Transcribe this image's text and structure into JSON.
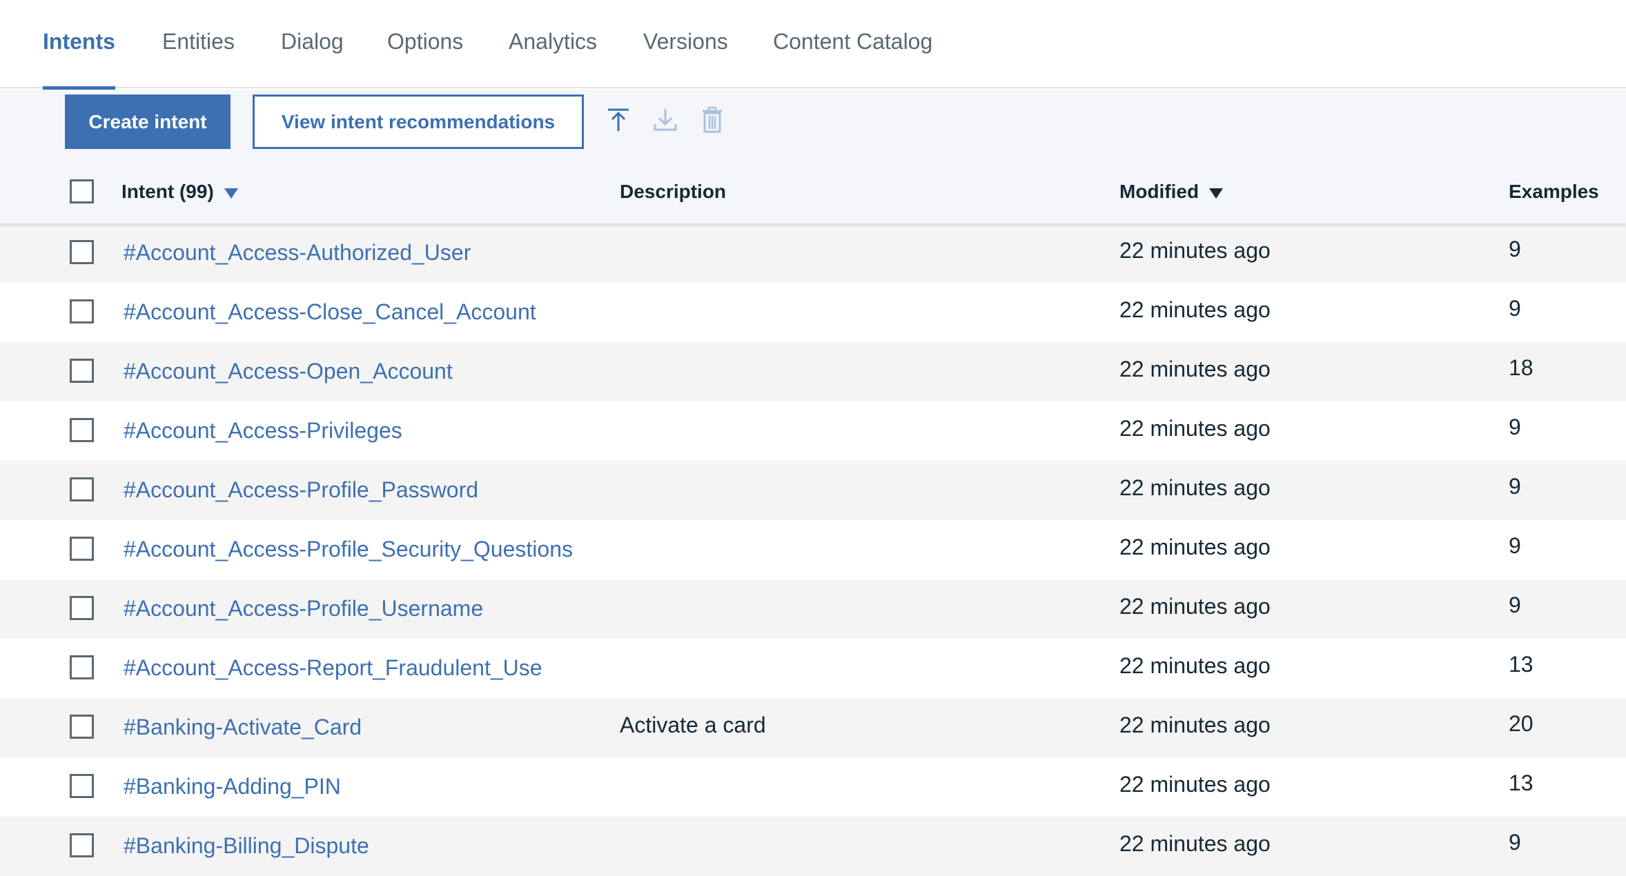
{
  "tabs": [
    {
      "label": "Intents",
      "active": true
    },
    {
      "label": "Entities"
    },
    {
      "label": "Dialog"
    },
    {
      "label": "Options"
    },
    {
      "label": "Analytics"
    },
    {
      "label": "Versions"
    },
    {
      "label": "Content Catalog"
    }
  ],
  "toolbar": {
    "create_label": "Create intent",
    "recommend_label": "View intent recommendations",
    "icons": [
      "upload-icon",
      "download-icon",
      "delete-icon"
    ]
  },
  "table": {
    "columns": {
      "intent": "Intent (99)",
      "description": "Description",
      "modified": "Modified",
      "examples": "Examples"
    },
    "rows": [
      {
        "name": "#Account_Access-Authorized_User",
        "description": "",
        "modified": "22 minutes ago",
        "examples": "9"
      },
      {
        "name": "#Account_Access-Close_Cancel_Account",
        "description": "",
        "modified": "22 minutes ago",
        "examples": "9"
      },
      {
        "name": "#Account_Access-Open_Account",
        "description": "",
        "modified": "22 minutes ago",
        "examples": "18"
      },
      {
        "name": "#Account_Access-Privileges",
        "description": "",
        "modified": "22 minutes ago",
        "examples": "9"
      },
      {
        "name": "#Account_Access-Profile_Password",
        "description": "",
        "modified": "22 minutes ago",
        "examples": "9"
      },
      {
        "name": "#Account_Access-Profile_Security_Questions",
        "description": "",
        "modified": "22 minutes ago",
        "examples": "9"
      },
      {
        "name": "#Account_Access-Profile_Username",
        "description": "",
        "modified": "22 minutes ago",
        "examples": "9"
      },
      {
        "name": "#Account_Access-Report_Fraudulent_Use",
        "description": "",
        "modified": "22 minutes ago",
        "examples": "13"
      },
      {
        "name": "#Banking-Activate_Card",
        "description": "Activate a card",
        "modified": "22 minutes ago",
        "examples": "20"
      },
      {
        "name": "#Banking-Adding_PIN",
        "description": "",
        "modified": "22 minutes ago",
        "examples": "13"
      },
      {
        "name": "#Banking-Billing_Dispute",
        "description": "",
        "modified": "22 minutes ago",
        "examples": "9"
      }
    ]
  },
  "colors": {
    "accent": "#3d70b2",
    "text": "#152935",
    "muted": "#5a6872",
    "icon_disabled": "#a9c1e0"
  }
}
